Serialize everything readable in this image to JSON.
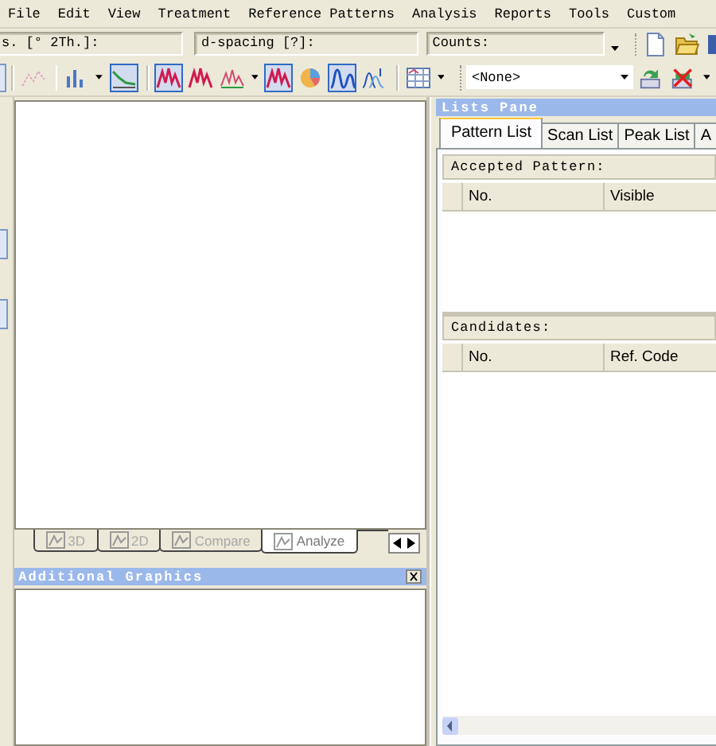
{
  "menu": [
    "File",
    "Edit",
    "View",
    "Treatment",
    "Reference Patterns",
    "Analysis",
    "Reports",
    "Tools",
    "Custom"
  ],
  "readouts": [
    "s. [° 2Th.]:",
    "d-spacing [?]:",
    "Counts:"
  ],
  "file_tools": [
    {
      "kind": "new"
    },
    {
      "kind": "open"
    },
    {
      "kind": "save"
    }
  ],
  "toolbar": [
    {
      "kind": "scatter",
      "selected": false,
      "has_menu": false,
      "sep_before": true
    },
    {
      "kind": "bars",
      "selected": false,
      "has_menu": true,
      "sep_before": true
    },
    {
      "kind": "line",
      "selected": true,
      "has_menu": false,
      "sep_before": false
    },
    {
      "kind": "peaks",
      "selected": true,
      "has_menu": false,
      "sep_before": true
    },
    {
      "kind": "peaks",
      "selected": false,
      "has_menu": false,
      "sep_before": false
    },
    {
      "kind": "peaks-outline",
      "selected": false,
      "has_menu": true,
      "sep_before": false
    },
    {
      "kind": "peaks",
      "selected": true,
      "has_menu": false,
      "sep_before": false
    },
    {
      "kind": "pie",
      "selected": false,
      "has_menu": false,
      "sep_before": false
    },
    {
      "kind": "wave",
      "selected": true,
      "has_menu": false,
      "sep_before": false
    },
    {
      "kind": "wave-stack",
      "selected": false,
      "has_menu": false,
      "sep_before": false
    },
    {
      "kind": "grid",
      "selected": false,
      "has_menu": true,
      "sep_before": true
    }
  ],
  "pattern_dropdown": {
    "value": "<None>"
  },
  "pattern_tools": [
    {
      "kind": "add",
      "has_menu": false
    },
    {
      "kind": "remove",
      "has_menu": true
    }
  ],
  "graph_tabs": [
    {
      "label": "3D",
      "selected": false
    },
    {
      "label": "2D",
      "selected": false
    },
    {
      "label": "Compare",
      "selected": false
    },
    {
      "label": "Analyze",
      "selected": true
    }
  ],
  "additional_graphics": {
    "title": "Additional Graphics"
  },
  "lists_pane": {
    "title": "Lists Pane",
    "tabs": [
      {
        "label": "Pattern List",
        "selected": true
      },
      {
        "label": "Scan List",
        "selected": false
      },
      {
        "label": "Peak List",
        "selected": false
      },
      {
        "label": "A",
        "selected": false
      }
    ],
    "accepted": {
      "title": "Accepted Pattern:",
      "columns": [
        "No.",
        "Visible"
      ]
    },
    "candidates": {
      "title": "Candidates:",
      "columns": [
        "No.",
        "Ref. Code"
      ]
    }
  }
}
